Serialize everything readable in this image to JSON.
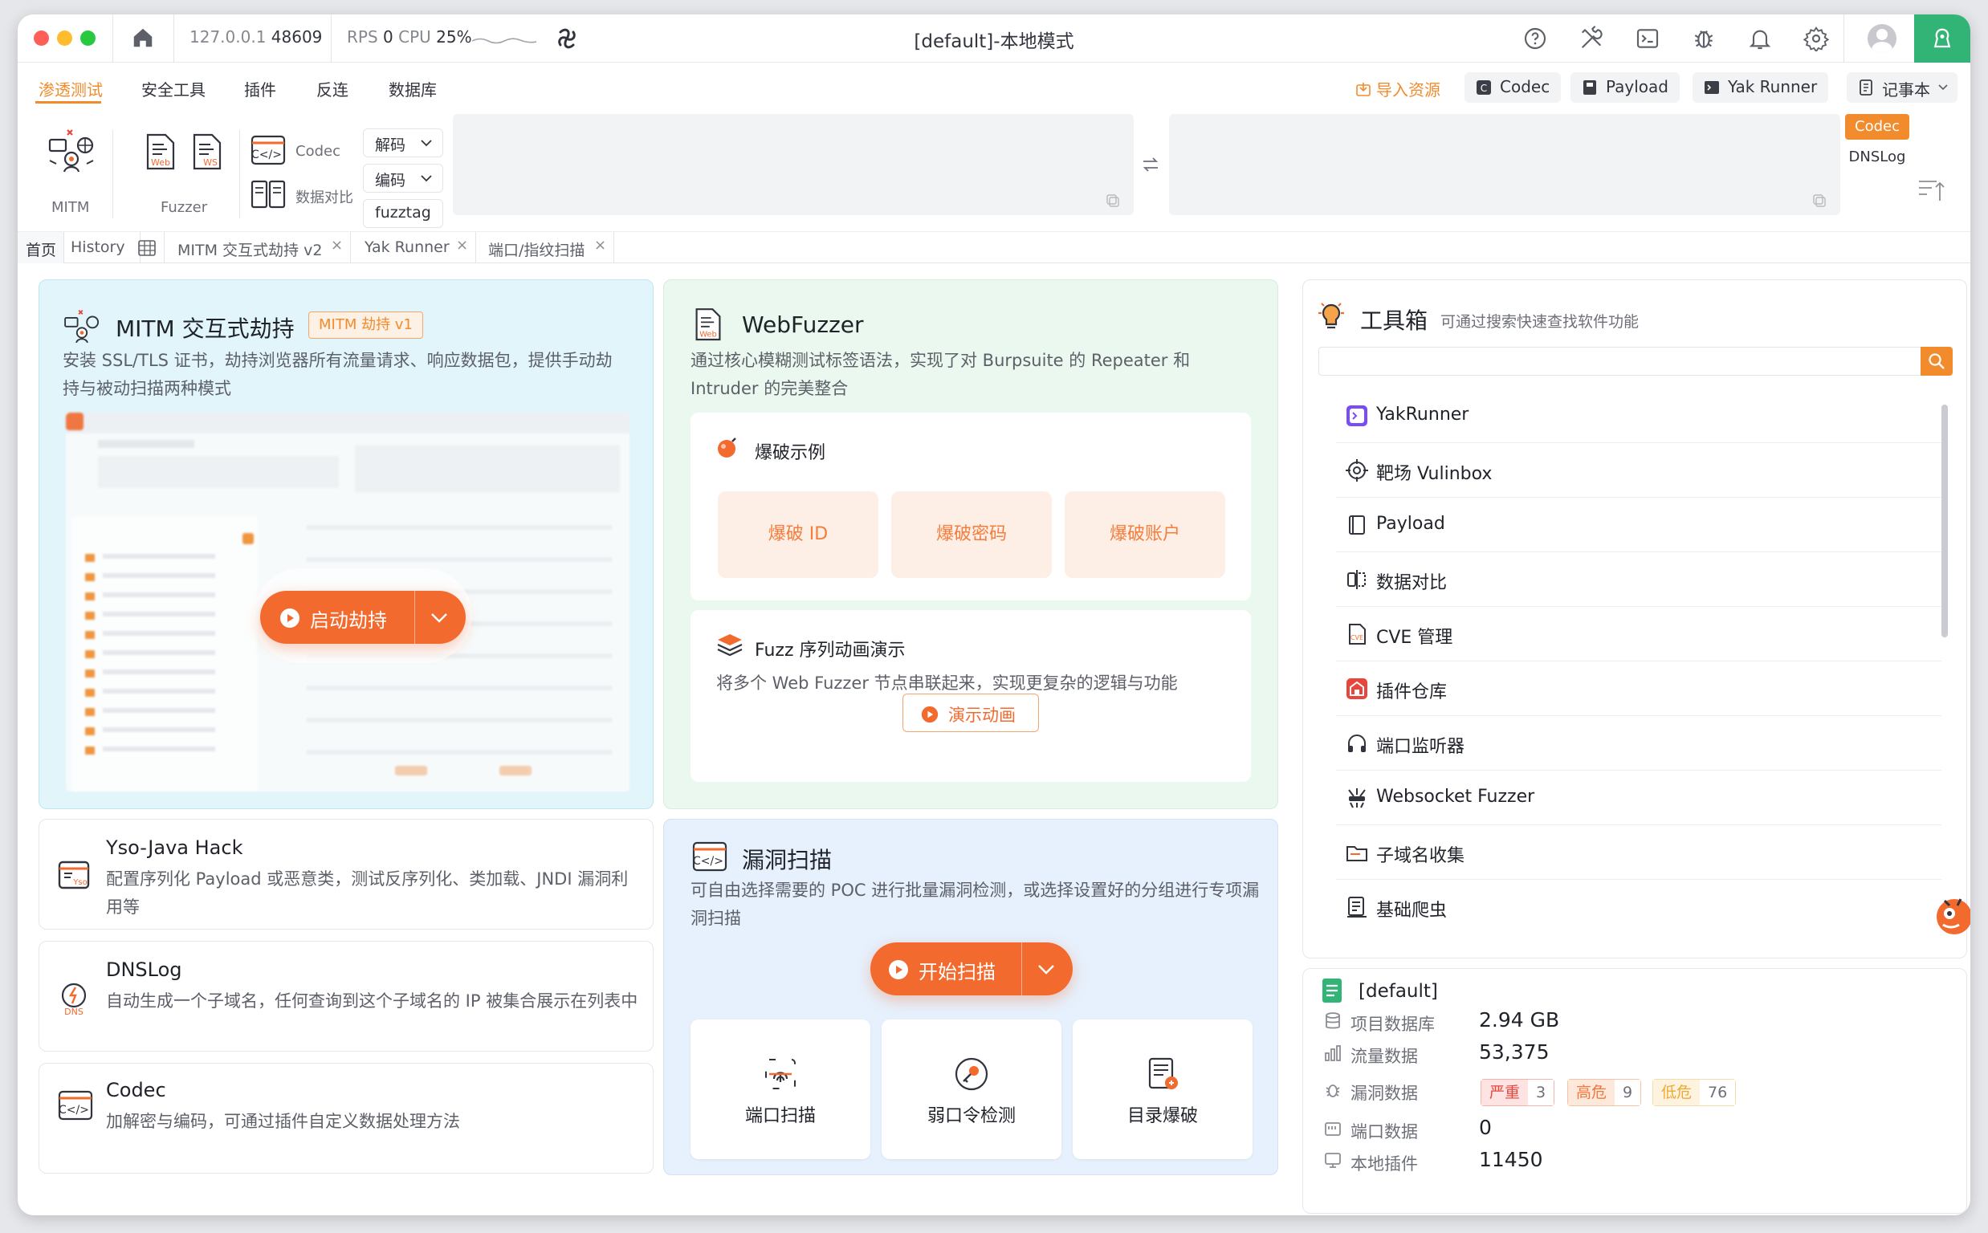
{
  "window_title": "[default]-本地模式",
  "titlebar": {
    "host": "127.0.0.1",
    "port": "48609",
    "rps_label": "RPS",
    "rps_value": "0",
    "cpu_label": "CPU",
    "cpu_value": "25%",
    "icons": [
      "help-icon",
      "tools-icon",
      "terminal-icon",
      "bug-icon",
      "bell-icon",
      "gear-icon",
      "user-avatar-icon",
      "yak-logo-icon"
    ]
  },
  "menu": {
    "items": [
      "渗透测试",
      "安全工具",
      "插件",
      "反连",
      "数据库"
    ],
    "active": "渗透测试"
  },
  "toolbar_right": {
    "import": "导入资源",
    "codec": "Codec",
    "payload": "Payload",
    "yak_runner": "Yak Runner",
    "notebook": "记事本"
  },
  "ribbon": {
    "mitm": "MITM",
    "fuzzer": "Fuzzer",
    "codec": "Codec",
    "compare": "数据对比",
    "decode": "解码",
    "encode": "编码",
    "fuzztag": "fuzztag",
    "side_codec": "Codec",
    "side_dnslog": "DNSLog"
  },
  "tabs": [
    "首页",
    "History",
    "MITM 交互式劫持 v2",
    "Yak Runner",
    "端口/指纹扫描"
  ],
  "mitm_card": {
    "title": "MITM 交互式劫持",
    "badge": "MITM 劫持 v1",
    "desc": "安装 SSL/TLS 证书，劫持浏览器所有流量请求、响应数据包，提供手动劫持与被动扫描两种模式",
    "button": "启动劫持"
  },
  "webfuzzer_card": {
    "title": "WebFuzzer",
    "desc": "通过核心模糊测试标签语法，实现了对 Burpsuite 的 Repeater 和 Intruder 的完美整合",
    "brute_title": "爆破示例",
    "brute_buttons": [
      "爆破 ID",
      "爆破密码",
      "爆破账户"
    ],
    "seq_title": "Fuzz 序列动画演示",
    "seq_desc": "将多个 Web Fuzzer 节点串联起来，实现更复杂的逻辑与功能",
    "seq_button": "演示动画"
  },
  "yso_card": {
    "title": "Yso-Java Hack",
    "desc": "配置序列化 Payload 或恶意类，测试反序列化、类加载、JNDI 漏洞利用等"
  },
  "dnslog_card": {
    "title": "DNSLog",
    "desc": "自动生成一个子域名，任何查询到这个子域名的 IP 被集合展示在列表中"
  },
  "codec_card": {
    "title": "Codec",
    "desc": "加解密与编码，可通过插件自定义数据处理方法"
  },
  "vuln_card": {
    "title": "漏洞扫描",
    "desc": "可自由选择需要的 POC 进行批量漏洞检测，或选择设置好的分组进行专项漏洞扫描",
    "button": "开始扫描",
    "scans": [
      "端口扫描",
      "弱口令检测",
      "目录爆破"
    ]
  },
  "toolbox": {
    "title": "工具箱",
    "subtitle": "可通过搜索快速查找软件功能",
    "search_placeholder": "",
    "items": [
      "YakRunner",
      "靶场 Vulinbox",
      "Payload",
      "数据对比",
      "CVE 管理",
      "插件仓库",
      "端口监听器",
      "Websocket Fuzzer",
      "子域名收集",
      "基础爬虫"
    ]
  },
  "project": {
    "name": "[default]",
    "rows": [
      {
        "label": "项目数据库",
        "value": "2.94 GB"
      },
      {
        "label": "流量数据",
        "value": "53,375"
      },
      {
        "label": "漏洞数据",
        "value": ""
      },
      {
        "label": "端口数据",
        "value": "0"
      },
      {
        "label": "本地插件",
        "value": "11450"
      }
    ],
    "vuln": [
      {
        "label": "严重",
        "count": "3",
        "color": "#e8453c"
      },
      {
        "label": "高危",
        "count": "9",
        "color": "#f2763a"
      },
      {
        "label": "低危",
        "count": "76",
        "color": "#f0a830"
      }
    ]
  },
  "colors": {
    "accent": "#f28b2c",
    "button": "#f26a2e",
    "mitm_bg": "#e2f5fb",
    "fuzzer_bg": "#eaf8ef",
    "vuln_bg": "#e6f1fd"
  }
}
